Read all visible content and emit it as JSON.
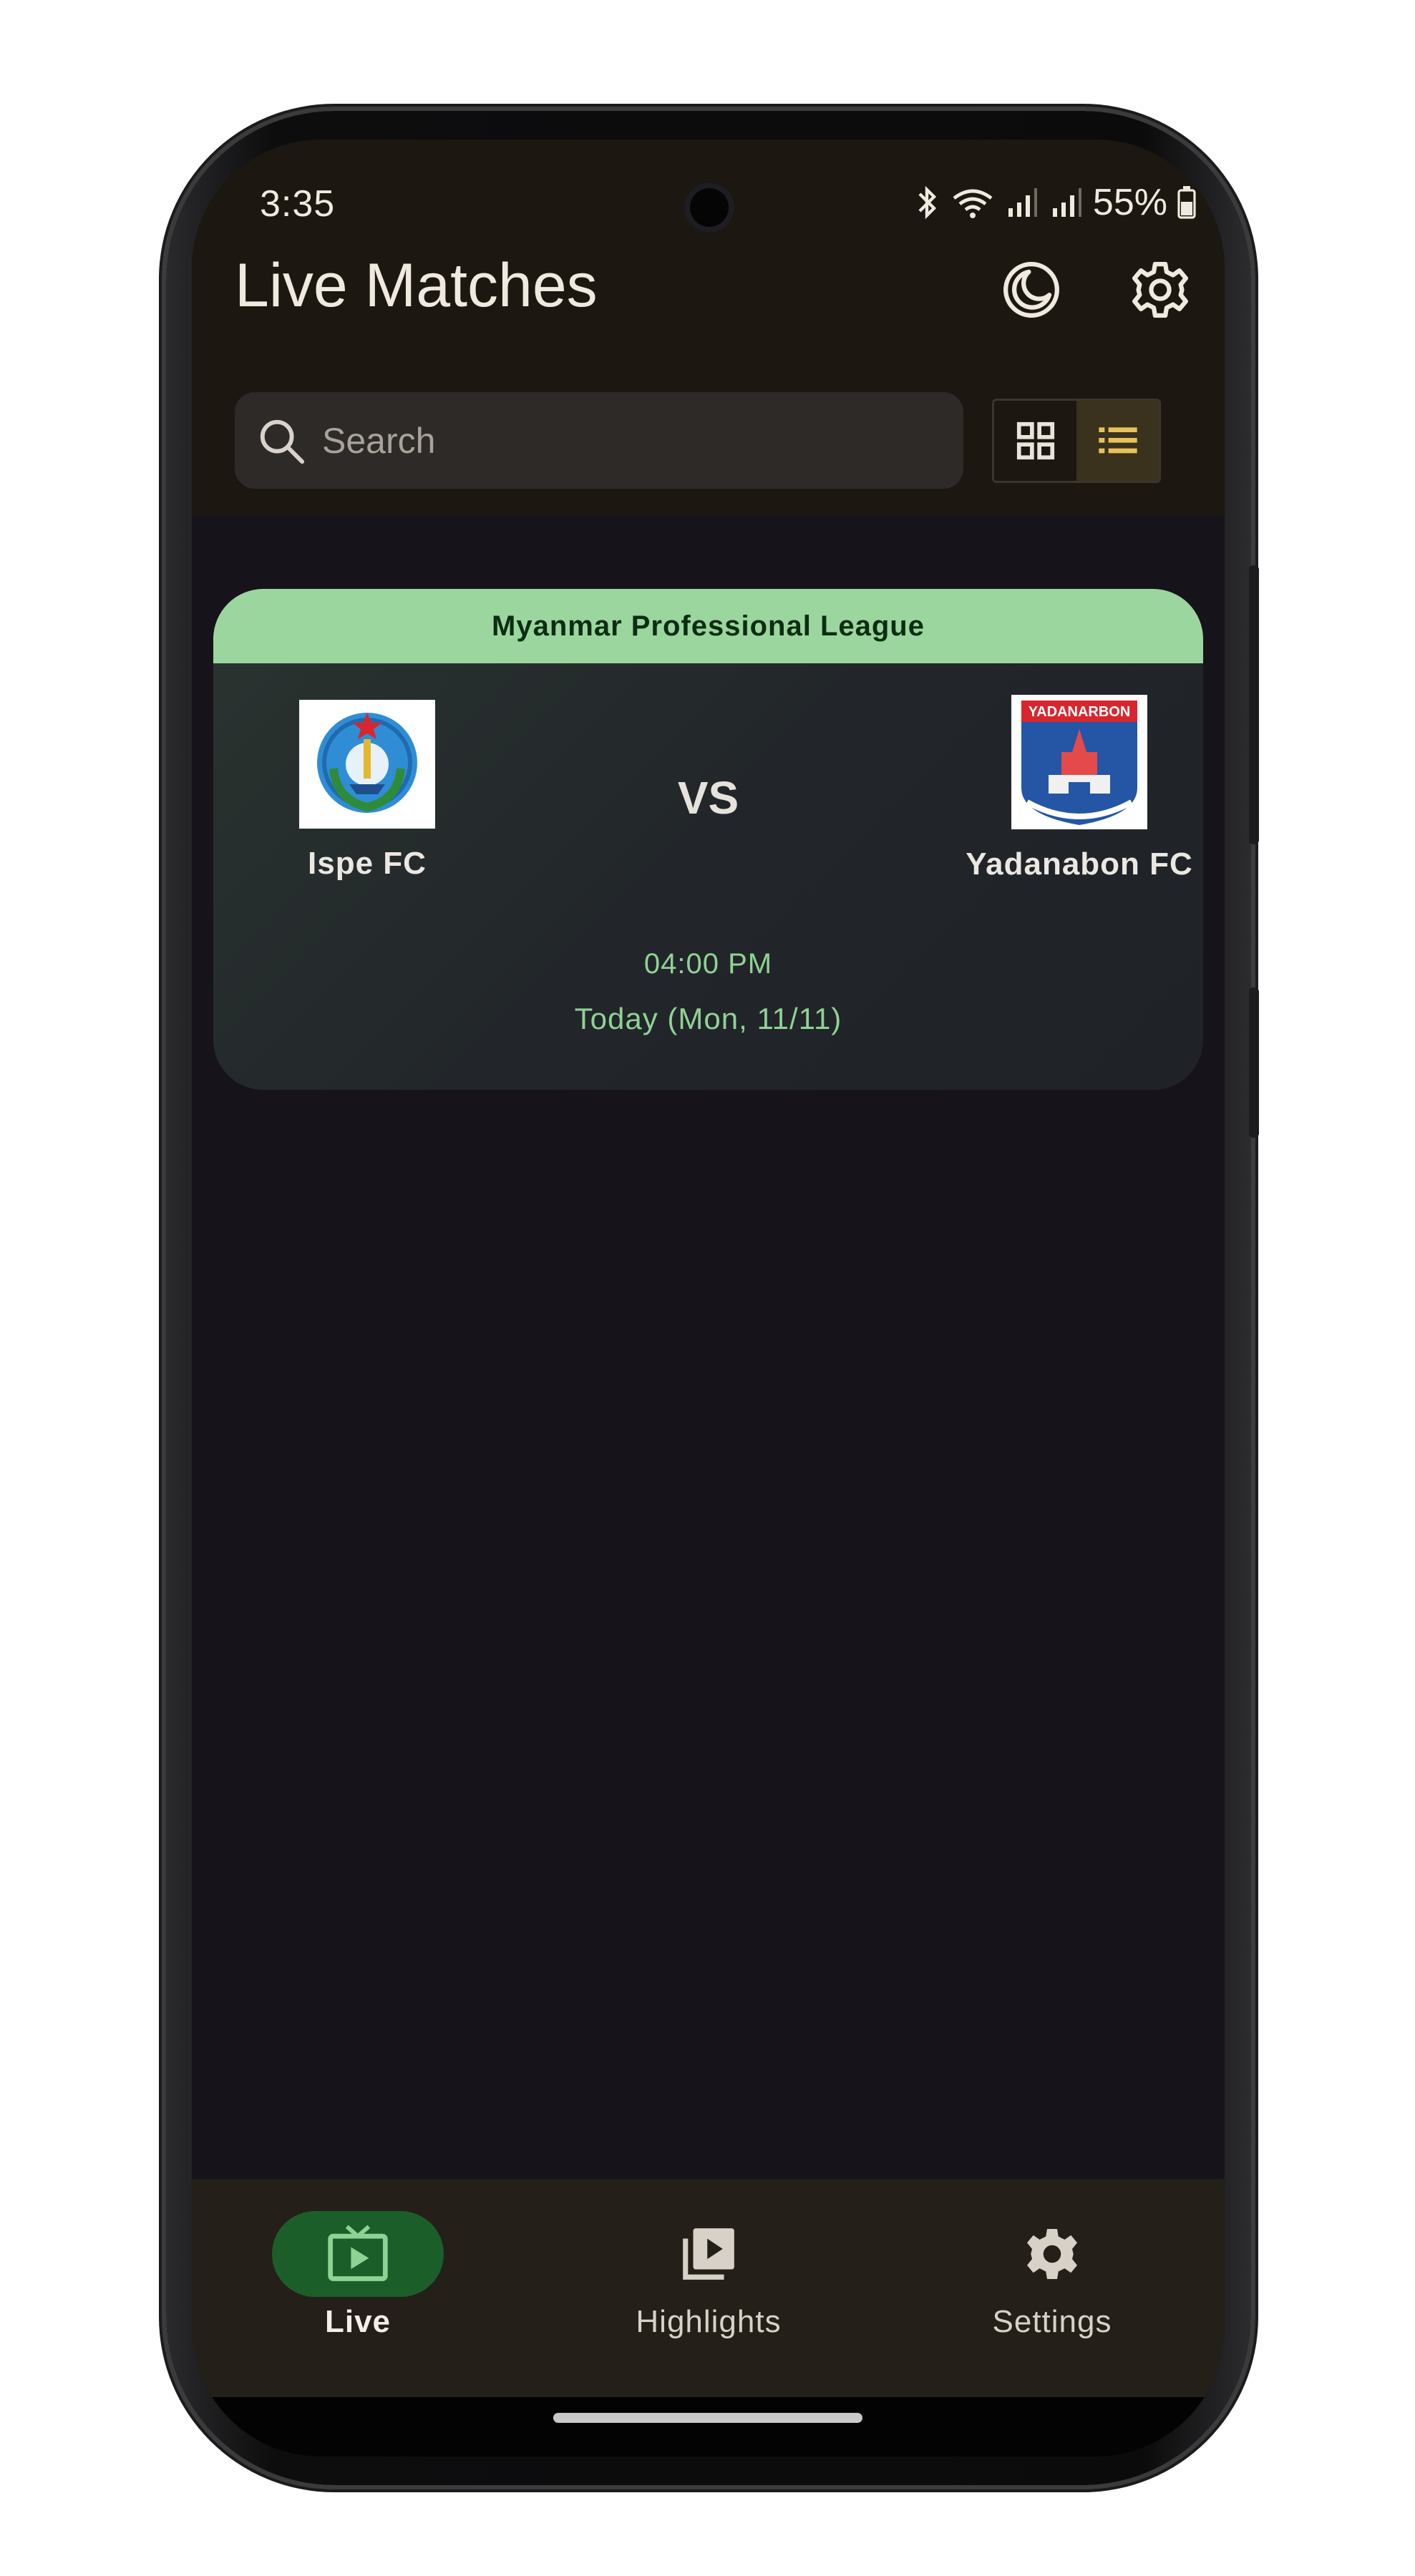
{
  "status_bar": {
    "time": "3:35",
    "battery_percent": "55%"
  },
  "header": {
    "title": "Live Matches",
    "theme_toggle_icon": "moon-icon",
    "settings_icon": "gear-icon"
  },
  "search": {
    "placeholder": "Search",
    "value": ""
  },
  "view_toggle": {
    "options": [
      "grid",
      "list"
    ],
    "selected": "list"
  },
  "match": {
    "league": "Myanmar Professional League",
    "home_team": "Ispe FC",
    "away_team": "Yadanabon FC",
    "vs_label": "VS",
    "time": "04:00 PM",
    "date": "Today (Mon, 11/11)",
    "away_logo_text": "YADANARBON"
  },
  "bottom_nav": {
    "items": [
      {
        "label": "Live",
        "icon": "live-tv-icon",
        "active": true
      },
      {
        "label": "Highlights",
        "icon": "video-library-icon",
        "active": false
      },
      {
        "label": "Settings",
        "icon": "gear-icon",
        "active": false
      }
    ]
  },
  "colors": {
    "accent_green": "#9cd69f",
    "active_pill": "#1b5e2a",
    "toggle_active": "#e7c15a"
  }
}
